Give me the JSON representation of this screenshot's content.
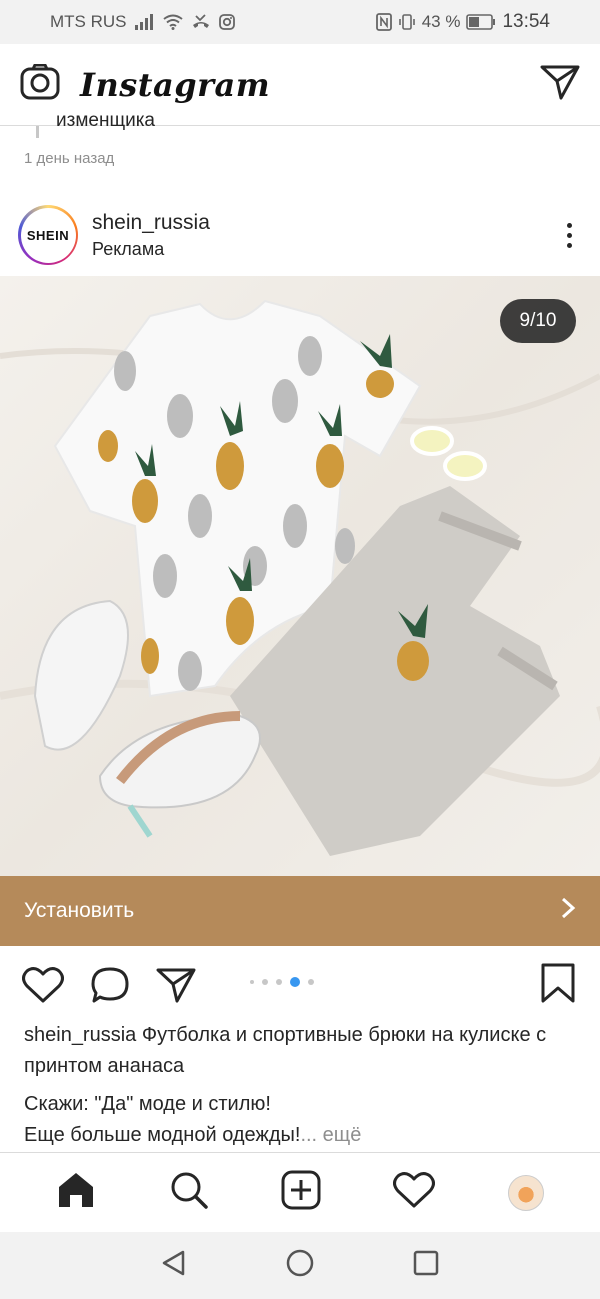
{
  "status_bar": {
    "carrier": "MTS RUS",
    "battery": "43 %",
    "time": "13:54",
    "icons": [
      "signal-icon",
      "wifi-icon",
      "missed-call-icon",
      "instagram-notif-icon",
      "nfc-icon",
      "vibrate-icon",
      "battery-icon"
    ]
  },
  "header": {
    "logo": "Instagram",
    "camera_icon": "camera-icon",
    "dm_icon": "direct-message-icon"
  },
  "prev_post": {
    "text": "изменщика",
    "time": "1 день назад"
  },
  "post": {
    "avatar_text": "SHEIN",
    "username": "shein_russia",
    "sponsored": "Реклама",
    "counter": "9/10",
    "cta": "Установить",
    "carousel": {
      "count": 5,
      "active_index": 3
    },
    "caption_username": "shein_russia",
    "caption_text": "Футболка и спортивные брюки на кулиске с принтом ананаса",
    "caption_line2": "Скажи: \"Да\" моде и стилю!",
    "caption_line3": "Еще больше модной одежды!",
    "more": "... ещё"
  },
  "bottom_nav": [
    "home-icon",
    "search-icon",
    "add-post-icon",
    "activity-heart-icon",
    "profile-avatar"
  ],
  "system_nav": [
    "back-icon",
    "home-circle-icon",
    "recents-icon"
  ],
  "colors": {
    "cta_bg": "#b58a5a",
    "active_dot": "#3897f0",
    "status_bar_bg": "#f2f2f2"
  }
}
